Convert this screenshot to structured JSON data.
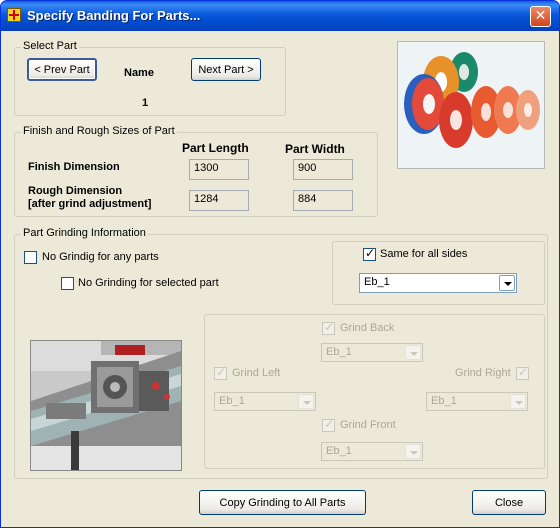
{
  "window": {
    "title": "Specify Banding For Parts...",
    "close_glyph": "✕"
  },
  "select_part": {
    "legend": "Select Part",
    "prev_label": "< Prev Part",
    "name_label": "Name",
    "next_label": "Next Part >",
    "part_number": "1"
  },
  "sizes": {
    "legend": "Finish and Rough Sizes of Part",
    "col_length": "Part Length",
    "col_width": "Part Width",
    "finish_label": "Finish Dimension",
    "rough_label_line1": "Rough Dimension",
    "rough_label_line2": "[after grind adjustment]",
    "finish_length": "1300",
    "finish_width": "900",
    "rough_length": "1284",
    "rough_width": "884"
  },
  "grinding": {
    "legend": "Part Grinding Information",
    "no_grind_any": "No Grindig for any parts",
    "no_grind_any_checked": false,
    "no_grind_selected": "No Grinding for selected part",
    "no_grind_selected_checked": false,
    "same_all_sides": "Same for all sides",
    "same_all_sides_checked": true,
    "all_sides_value": "Eb_1",
    "back_label": "Grind Back",
    "back_value": "Eb_1",
    "left_label": "Grind Left",
    "left_value": "Eb_1",
    "right_label": "Grind Right",
    "right_value": "Eb_1",
    "front_label": "Grind Front",
    "front_value": "Eb_1"
  },
  "footer": {
    "copy_label": "Copy Grinding to All Parts",
    "close_label": "Close"
  },
  "colors": {
    "titlebar": "#0054e3",
    "dialog_bg": "#ece9d8"
  }
}
